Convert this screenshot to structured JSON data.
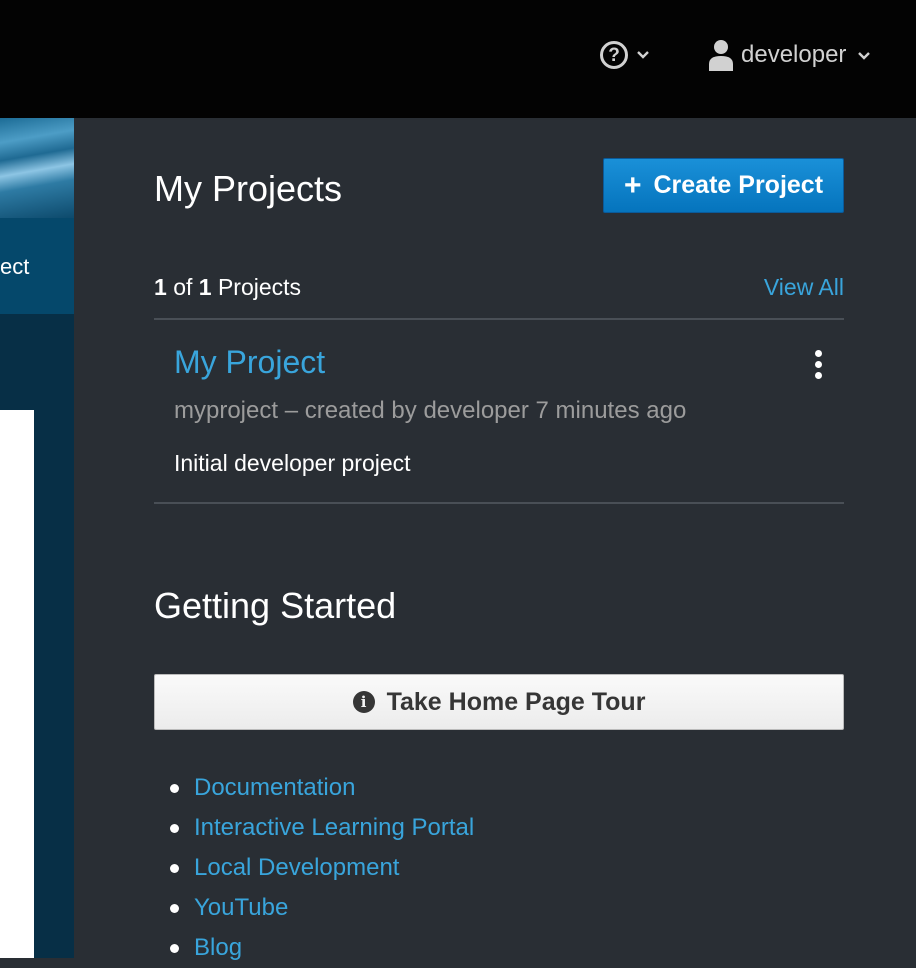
{
  "topbar": {
    "help_icon": "question-circle-icon",
    "user_icon": "user-icon",
    "username": "developer"
  },
  "left_panel": {
    "partial_text": "ect"
  },
  "my_projects": {
    "title": "My Projects",
    "create_button_label": "Create Project",
    "count": {
      "current": "1",
      "of_label": "of",
      "total": "1",
      "suffix": "Projects"
    },
    "view_all_label": "View All",
    "project": {
      "name": "My Project",
      "meta": "myproject – created by developer 7 minutes ago",
      "description": "Initial developer project"
    }
  },
  "getting_started": {
    "title": "Getting Started",
    "tour_button_label": "Take Home Page Tour",
    "tour_icon": "info-circle-icon",
    "links": [
      "Documentation",
      "Interactive Learning Portal",
      "Local Development",
      "YouTube",
      "Blog"
    ]
  },
  "colors": {
    "navbar": "#030303",
    "panel_bg": "#292e34",
    "link": "#39a5dc",
    "primary_button": "#0088ce",
    "divider": "#494f56"
  }
}
